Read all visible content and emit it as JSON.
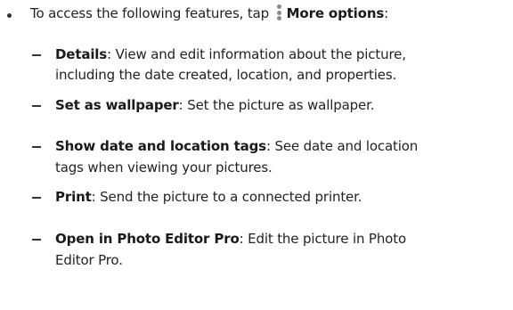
{
  "intro": {
    "text_before": "To access the following features, tap",
    "icon": "more-options-vertical-dots-icon",
    "bold": "More options",
    "text_after": ":"
  },
  "items": [
    {
      "term": "Details",
      "desc_line1": ": View and edit information about the picture,",
      "desc_line2": "including the date created, location, and properties."
    },
    {
      "term": "Set as wallpaper",
      "desc_line1": ": Set the picture as wallpaper."
    },
    {
      "term": "Show date and location tags",
      "desc_line1": ": See date and location",
      "desc_line2": "tags when viewing your pictures."
    },
    {
      "term": "Print",
      "desc_line1": ": Send the picture to a connected printer."
    },
    {
      "term": "Open in Photo Editor Pro",
      "desc_line1": ": Edit the picture in Photo",
      "desc_line2": "Editor Pro."
    }
  ]
}
